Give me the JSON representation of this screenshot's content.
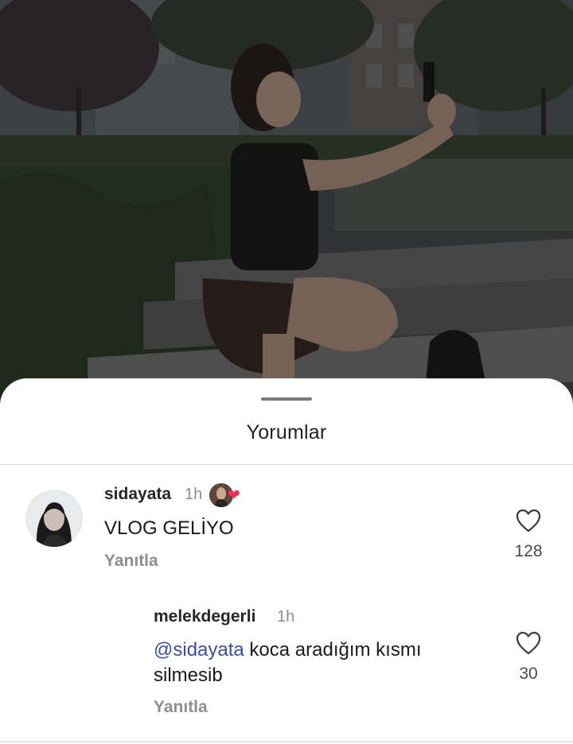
{
  "sheet": {
    "title": "Yorumlar"
  },
  "comments": [
    {
      "username": "sidayata",
      "time": "1h",
      "text": "VLOG GELİYO",
      "reply_label": "Yanıtla",
      "like_count": "128",
      "has_creator_like_badge": true
    },
    {
      "username": "melekdegerli",
      "time": "1h",
      "mention": "@sidayata",
      "text_line1": " koca aradığım kısmı",
      "text_line2": "silmesib",
      "reply_label": "Yanıtla",
      "like_count": "30"
    }
  ],
  "icons": {
    "heart": "heart-outline-icon",
    "creator_heart": "red-heart-icon"
  },
  "colors": {
    "mention": "#3d4d9e",
    "creator_heart": "#ff2d55",
    "secondary_text": "#8e8e8e"
  }
}
